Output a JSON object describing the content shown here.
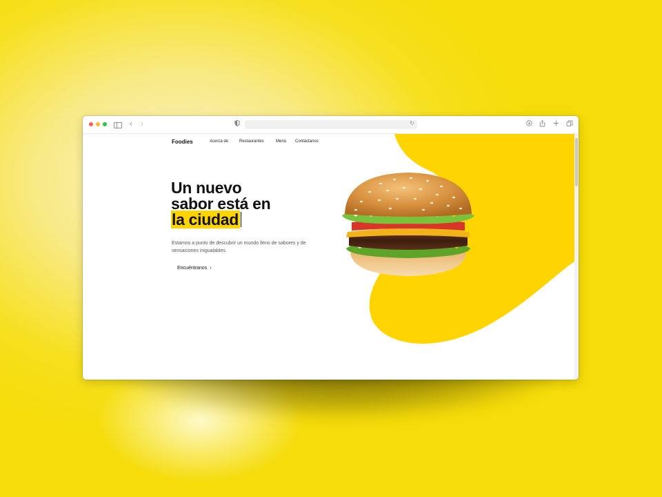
{
  "nav": {
    "brand": "Foodies",
    "links": [
      "Acerca de",
      "Restaurantes",
      "Menú",
      "Contáctanos"
    ]
  },
  "hero": {
    "headline_line1": "Un nuevo",
    "headline_line2": "sabor está en",
    "headline_highlight": "la ciudad",
    "description": "Estamos a punto de descubrir un mundo lleno de sabores y de sensaciones inigualables.",
    "cta_label": "Encuéntranos",
    "cta_arrow": "›"
  },
  "browser": {
    "back": "‹",
    "forward": "›",
    "reload": "↻"
  },
  "colors": {
    "accent": "#ffd400",
    "background": "#f7e01e"
  },
  "image": {
    "name": "hamburger-photo"
  }
}
